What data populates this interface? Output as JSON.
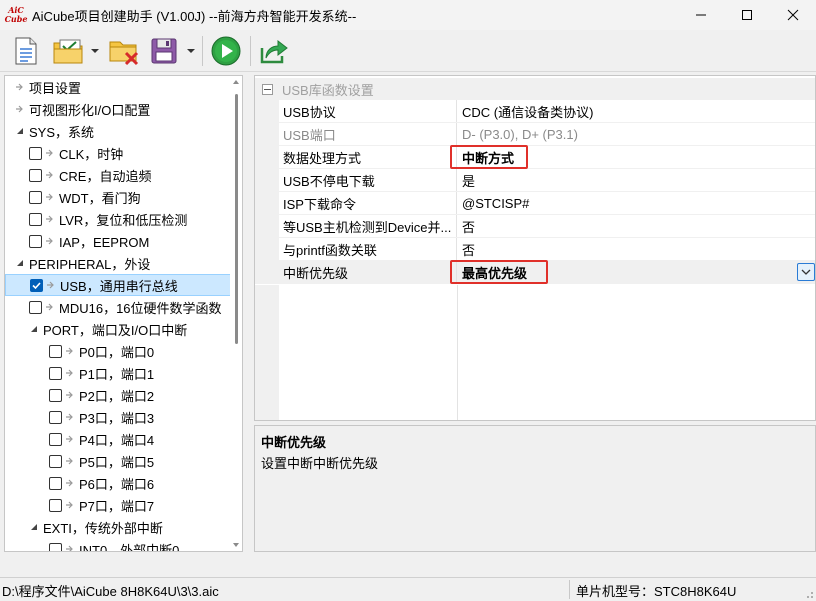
{
  "window": {
    "logo_text_top": "AiC",
    "logo_text_bottom": "Cube",
    "title": "AiCube项目创建助手 (V1.00J) --前海方舟智能开发系统--"
  },
  "toolbar": {
    "icons": [
      "new-document-icon",
      "open-folder-icon",
      "close-folder-icon",
      "save-icon",
      "run-icon",
      "export-icon"
    ]
  },
  "tree": {
    "items": [
      {
        "label": "项目设置",
        "level": 0,
        "kind": "arrow"
      },
      {
        "label": "可视图形化I/O口配置",
        "level": 0,
        "kind": "arrow"
      },
      {
        "label": "SYS，系统",
        "level": 0,
        "kind": "expanded"
      },
      {
        "label": "CLK，时钟",
        "level": 1,
        "kind": "check",
        "checked": false
      },
      {
        "label": "CRE，自动追频",
        "level": 1,
        "kind": "check",
        "checked": false
      },
      {
        "label": "WDT，看门狗",
        "level": 1,
        "kind": "check",
        "checked": false
      },
      {
        "label": "LVR，复位和低压检测",
        "level": 1,
        "kind": "check",
        "checked": false
      },
      {
        "label": "IAP，EEPROM",
        "level": 1,
        "kind": "check",
        "checked": false
      },
      {
        "label": "PERIPHERAL，外设",
        "level": 0,
        "kind": "expanded"
      },
      {
        "label": "USB，通用串行总线",
        "level": 1,
        "kind": "check",
        "checked": true,
        "selected": true
      },
      {
        "label": "MDU16，16位硬件数学函数",
        "level": 1,
        "kind": "check",
        "checked": false
      },
      {
        "label": "PORT，端口及I/O口中断",
        "level": 1,
        "kind": "expanded"
      },
      {
        "label": "P0口，端口0",
        "level": 2,
        "kind": "check",
        "checked": false
      },
      {
        "label": "P1口，端口1",
        "level": 2,
        "kind": "check",
        "checked": false
      },
      {
        "label": "P2口，端口2",
        "level": 2,
        "kind": "check",
        "checked": false
      },
      {
        "label": "P3口，端口3",
        "level": 2,
        "kind": "check",
        "checked": false
      },
      {
        "label": "P4口，端口4",
        "level": 2,
        "kind": "check",
        "checked": false
      },
      {
        "label": "P5口，端口5",
        "level": 2,
        "kind": "check",
        "checked": false
      },
      {
        "label": "P6口，端口6",
        "level": 2,
        "kind": "check",
        "checked": false
      },
      {
        "label": "P7口，端口7",
        "level": 2,
        "kind": "check",
        "checked": false
      },
      {
        "label": "EXTI，传统外部中断",
        "level": 1,
        "kind": "expanded"
      },
      {
        "label": "INT0，外部中断0",
        "level": 2,
        "kind": "check",
        "checked": false
      }
    ]
  },
  "properties": {
    "category": "USB库函数设置",
    "rows": [
      {
        "name": "USB协议",
        "value": "CDC (通信设备类协议)",
        "disabled": false,
        "bold": false
      },
      {
        "name": "USB端口",
        "value": "D- (P3.0), D+ (P3.1)",
        "disabled": true,
        "bold": false
      },
      {
        "name": "数据处理方式",
        "value": "中断方式",
        "disabled": false,
        "bold": true,
        "boxed": true
      },
      {
        "name": "USB不停电下载",
        "value": "是",
        "disabled": false,
        "bold": false
      },
      {
        "name": "ISP下载命令",
        "value": "@STCISP#",
        "disabled": false,
        "bold": false
      },
      {
        "name": "等USB主机检测到Device并...",
        "value": "否",
        "disabled": false,
        "bold": false
      },
      {
        "name": "与printf函数关联",
        "value": "否",
        "disabled": false,
        "bold": false
      },
      {
        "name": "中断优先级",
        "value": "最高优先级",
        "disabled": false,
        "bold": true,
        "boxed": true,
        "selected": true
      }
    ]
  },
  "description": {
    "title": "中断优先级",
    "text": "设置中断中断优先级"
  },
  "status": {
    "path": "D:\\程序文件\\AiCube  8H8K64U\\3\\3.aic",
    "model": "单片机型号：STC8H8K64U"
  }
}
